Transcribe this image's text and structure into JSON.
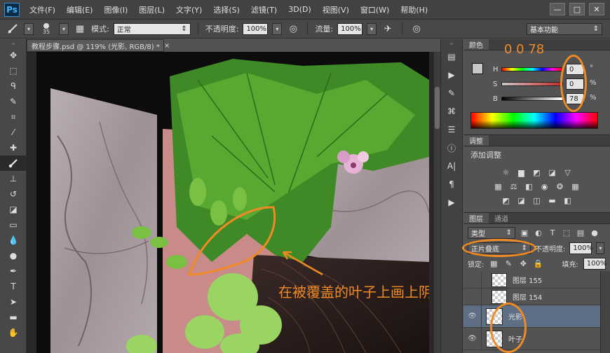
{
  "menubar": {
    "logo": "Ps",
    "items": [
      "文件(F)",
      "编辑(E)",
      "图像(I)",
      "图层(L)",
      "文字(Y)",
      "选择(S)",
      "滤镜(T)",
      "3D(D)",
      "视图(V)",
      "窗口(W)",
      "帮助(H)"
    ],
    "minimize": "—",
    "restore": "□",
    "close": "✕"
  },
  "options": {
    "brush_size": "35",
    "mode_label": "模式:",
    "mode_value": "正常",
    "opacity_label": "不透明度:",
    "opacity_value": "100%",
    "flow_label": "流量:",
    "flow_value": "100%",
    "workspace": "基本功能"
  },
  "document": {
    "tab_title": "教程步骤.psd @ 119% (光影, RGB/8) *",
    "tab_close": "×"
  },
  "annotations": {
    "color_values": "0  0  78",
    "instruction": "在被覆盖的叶子上画上阴影"
  },
  "color_panel": {
    "tab": "颜色",
    "h_label": "H",
    "h_value": "0",
    "h_unit": "°",
    "s_label": "S",
    "s_value": "0",
    "s_unit": "%",
    "b_label": "B",
    "b_value": "78",
    "b_unit": "%",
    "foreground_color": "#c7c7c7"
  },
  "adjust_panel": {
    "tab": "调整",
    "title": "添加调整"
  },
  "layers_panel": {
    "tabs": [
      "图层",
      "通道"
    ],
    "filter_kind": "类型",
    "blend_mode": "正片叠底",
    "opacity_label": "不透明度:",
    "opacity_value": "100%",
    "lock_label": "锁定:",
    "fill_label": "填充:",
    "fill_value": "100%",
    "layers": [
      {
        "name": "图层 155",
        "visible": false,
        "selected": false
      },
      {
        "name": "图层 154",
        "visible": false,
        "selected": false
      },
      {
        "name": "光影",
        "visible": true,
        "selected": true
      },
      {
        "name": "叶子",
        "visible": true,
        "selected": false
      }
    ]
  },
  "colors": {
    "annotation_orange": "#f08a24",
    "menubar_bg": "#424242",
    "panel_bg": "#535353",
    "selected_layer": "#5d6e85"
  }
}
